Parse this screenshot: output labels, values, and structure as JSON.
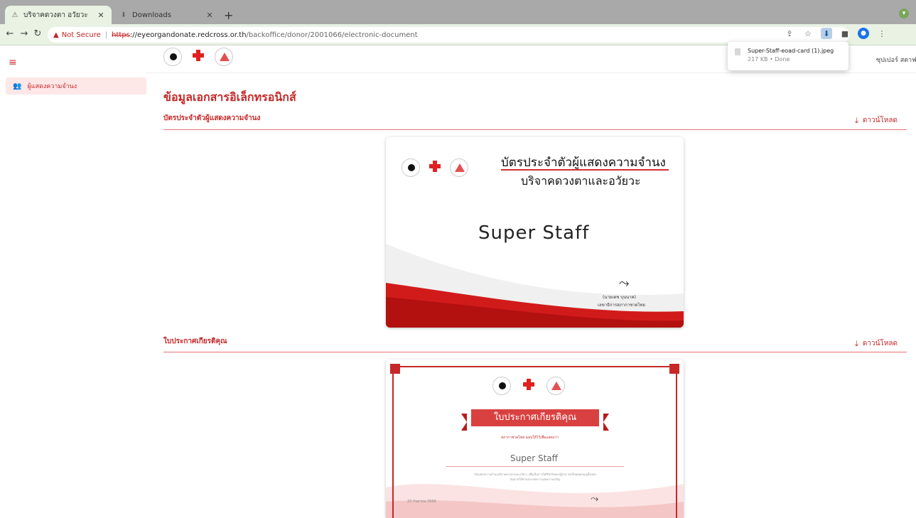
{
  "browser": {
    "tabs": [
      {
        "label": "บริจาคดวงตา อวัยวะ",
        "active": true
      },
      {
        "label": "Downloads",
        "active": false
      }
    ],
    "new_tab": "+",
    "security_label": "Not Secure",
    "url_scheme": "https",
    "url_host": "://eyeorgandonate.redcross.or.th",
    "url_path": "/backoffice/donor/2001066/electronic-document"
  },
  "download_popup": {
    "file_name": "Super-Staff-eoad-card (1).jpeg",
    "status": "217 KB • Done"
  },
  "sidebar": {
    "items": [
      {
        "label": "ผู้แสดงความจำนง",
        "icon": "people-icon"
      }
    ]
  },
  "header": {
    "user_name": "ซุปเปอร์ สตาฟ"
  },
  "main": {
    "title": "ข้อมูลเอกสารอิเล็กทรอนิกส์",
    "sections": [
      {
        "title": "บัตรประจำตัวผู้แสดงความจำนง",
        "download_label": "ดาวน์โหลด"
      },
      {
        "title": "ใบประกาศเกียรติคุณ",
        "download_label": "ดาวน์โหลด"
      }
    ]
  },
  "card": {
    "heading": "บัตรประจำตัวผู้แสดงความจำนง",
    "subheading": "บริจาคดวงตาและอวัยวะ",
    "name": "Super  Staff",
    "signer_name": "(นายเตช บุนนาค)",
    "signer_position": "เลขาธิการสภากาชาดไทย"
  },
  "certificate": {
    "banner": "ใบประกาศเกียรติคุณ",
    "small_text": "สภากาชาดไทย มอบให้ไว้เพื่อแสดงว่า",
    "name": "Super Staff",
    "body": "ได้แสดงความจำนงบริจาคดวงตาและอวัยวะ เพื่อเป็นการให้ชีวิตใหม่แก่ผู้ป่วย ขอให้กุศลผลบุญนี้จงดลบันดาลให้ท่านประสบความสุขความเจริญ",
    "date": "23 กันยายน 2566"
  },
  "colors": {
    "accent": "#c62828",
    "sidebar_active_bg": "#fde7e7"
  }
}
